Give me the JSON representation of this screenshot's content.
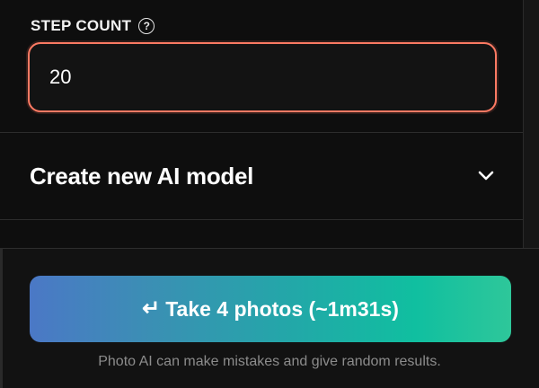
{
  "step_count": {
    "label": "STEP COUNT",
    "help_glyph": "?",
    "value": "20",
    "focus_color": "#ff7a63"
  },
  "accordion": {
    "title": "Create new AI model",
    "expanded": false
  },
  "footer": {
    "button_icon": "↵",
    "button_label": "Take 4 photos (~1m31s)",
    "disclaimer": "Photo AI can make mistakes and give random results.",
    "gradient_start": "#4b78c6",
    "gradient_end": "#2ec79a"
  }
}
